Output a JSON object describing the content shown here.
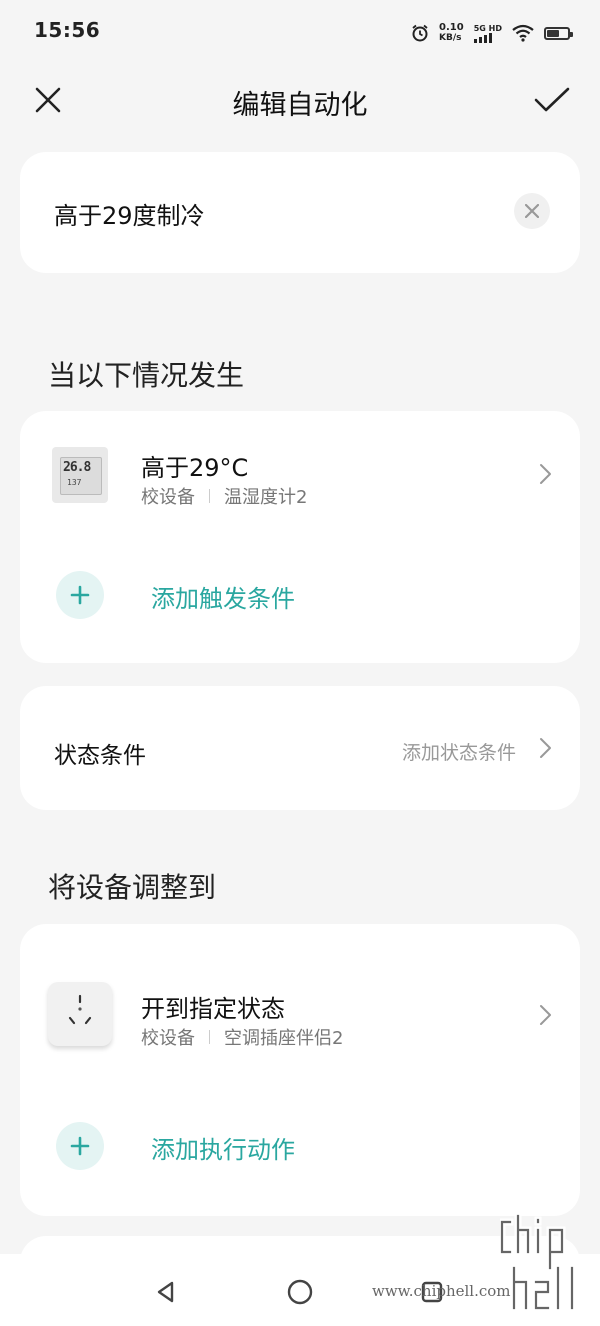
{
  "status_bar": {
    "time": "15:56",
    "net_speed": "0.10",
    "net_unit": "KB/s",
    "network_type": "5G HD",
    "battery_level": 0.55,
    "icons": [
      "alarm-icon",
      "signal-icon",
      "wifi-icon",
      "battery-icon"
    ]
  },
  "header": {
    "title": "编辑自动化",
    "close_icon": "close-icon",
    "confirm_icon": "check-icon"
  },
  "automation": {
    "name": "高于29度制冷"
  },
  "triggers": {
    "section_title": "当以下情况发生",
    "items": [
      {
        "title": "高于29°C",
        "location": "校设备",
        "device": "温湿度计2",
        "thumb_reading": "26.8",
        "thumb_sub": "137"
      }
    ],
    "add_label": "添加触发条件"
  },
  "state_conditions": {
    "label": "状态条件",
    "hint": "添加状态条件"
  },
  "actions": {
    "section_title": "将设备调整到",
    "items": [
      {
        "title": "开到指定状态",
        "location": "校设备",
        "device": "空调插座伴侣2"
      }
    ],
    "add_label": "添加执行动作"
  },
  "watermark": {
    "url": "www.chiphell.com",
    "logo_text": "chip hell"
  },
  "colors": {
    "accent": "#2aa7a0",
    "accent_bg": "#e4f4f3",
    "background": "#f5f5f5"
  }
}
